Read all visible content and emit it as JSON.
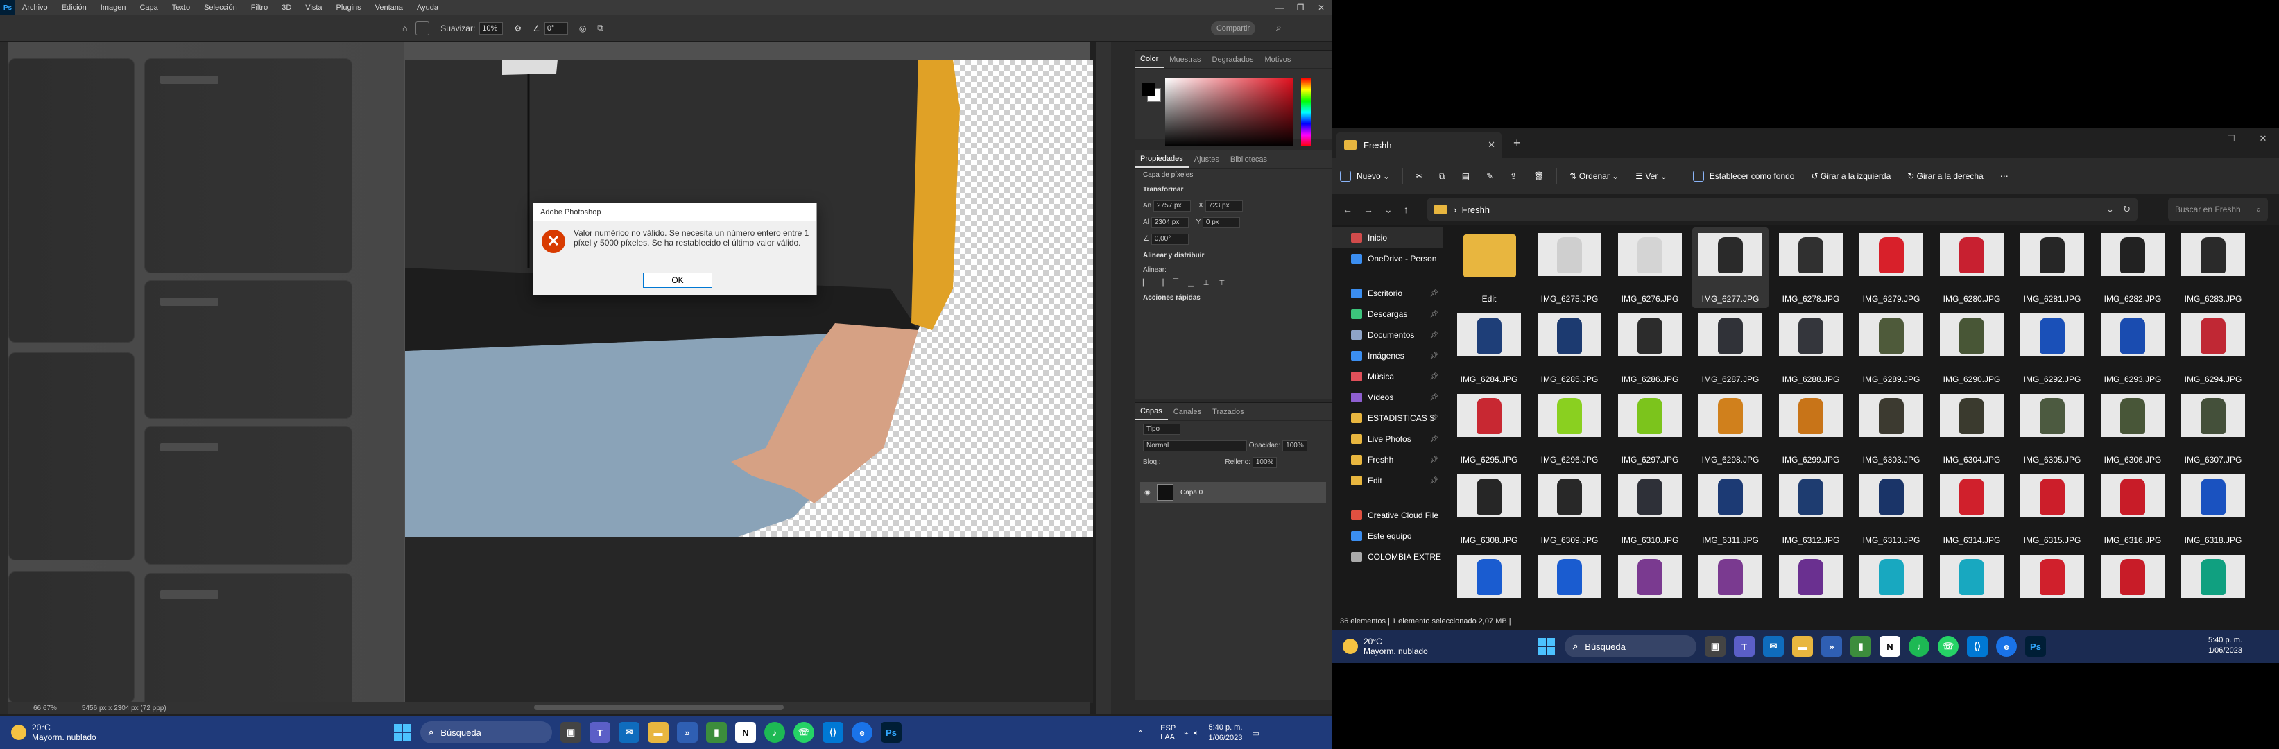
{
  "photoshop": {
    "menus": [
      "Archivo",
      "Edición",
      "Imagen",
      "Capa",
      "Texto",
      "Selección",
      "Filtro",
      "3D",
      "Vista",
      "Plugins",
      "Ventana",
      "Ayuda"
    ],
    "options": {
      "smooth_label": "Suavizar:",
      "smooth_value": "10%",
      "angle_value": "0°",
      "share_label": "Compartir"
    },
    "dialog": {
      "title": "Adobe Photoshop",
      "message": "Valor numérico no válido. Se necesita un número entero entre 1 píxel y 5000 píxeles. Se ha restablecido el último valor válido.",
      "ok_label": "OK"
    },
    "status": {
      "zoom": "66,67%",
      "size": "5456 px x 2304 px (72 ppp)"
    },
    "color_panel": {
      "tabs": [
        "Color",
        "Muestras",
        "Degradados",
        "Motivos"
      ]
    },
    "properties_panel": {
      "tabs": [
        "Propiedades",
        "Ajustes",
        "Bibliotecas"
      ],
      "type_label": "Capa de píxeles",
      "transform_title": "Transformar",
      "width_label": "An",
      "width_value": "2757 px",
      "x_label": "X",
      "x_value": "723 px",
      "height_label": "Al",
      "height_value": "2304 px",
      "y_label": "Y",
      "y_value": "0 px",
      "angle_value": "0,00°",
      "align_title": "Alinear y distribuir",
      "align_sub": "Alinear:",
      "quick_title": "Acciones rápidas"
    },
    "layers_panel": {
      "tabs": [
        "Capas",
        "Canales",
        "Trazados"
      ],
      "kind": "Tipo",
      "blend_mode": "Normal",
      "opacity_label": "Opacidad:",
      "opacity_value": "100%",
      "lock_label": "Bloq.:",
      "fill_label": "Relleno:",
      "fill_value": "100%",
      "layer_name": "Capa 0"
    }
  },
  "taskbar_left": {
    "weather_temp": "20°C",
    "weather_desc": "Mayorm. nublado",
    "search_label": "Búsqueda",
    "lang": "ESP",
    "lang2": "LAA",
    "time": "5:40 p. m.",
    "date": "1/06/2023"
  },
  "explorer": {
    "tab_title": "Freshh",
    "commands": {
      "new": "Nuevo",
      "sort": "Ordenar",
      "view": "Ver",
      "wallpaper": "Establecer como fondo",
      "rotate_left": "Girar a la izquierda",
      "rotate_right": "Girar a la derecha"
    },
    "path": "Freshh",
    "search_placeholder": "Buscar en Freshh",
    "sidebar": [
      {
        "label": "Inicio",
        "color": "#d14b4b"
      },
      {
        "label": "OneDrive - Person",
        "color": "#3b8ef0"
      },
      {
        "label": "Escritorio",
        "color": "#3b8ef0"
      },
      {
        "label": "Descargas",
        "color": "#3cc47c"
      },
      {
        "label": "Documentos",
        "color": "#8ea4c8"
      },
      {
        "label": "Imágenes",
        "color": "#3b8ef0"
      },
      {
        "label": "Música",
        "color": "#e0505a"
      },
      {
        "label": "Vídeos",
        "color": "#8e5fd0"
      },
      {
        "label": "ESTADISTICAS S",
        "color": "#e8b63f"
      },
      {
        "label": "Live Photos",
        "color": "#e8b63f"
      },
      {
        "label": "Freshh",
        "color": "#e8b63f"
      },
      {
        "label": "Edit",
        "color": "#e8b63f"
      },
      {
        "label": "Creative Cloud File",
        "color": "#e05040"
      },
      {
        "label": "Este equipo",
        "color": "#3b8ef0"
      },
      {
        "label": "COLOMBIA EXTRE",
        "color": "#aaaaaa"
      }
    ],
    "files": [
      {
        "name": "Edit",
        "color": "folder"
      },
      {
        "name": "IMG_6275.JPG",
        "color": "#cfcfcf"
      },
      {
        "name": "IMG_6276.JPG",
        "color": "#d4d4d4"
      },
      {
        "name": "IMG_6277.JPG",
        "color": "#2a2a2a"
      },
      {
        "name": "IMG_6278.JPG",
        "color": "#303030"
      },
      {
        "name": "IMG_6279.JPG",
        "color": "#d8202a"
      },
      {
        "name": "IMG_6280.JPG",
        "color": "#c82030"
      },
      {
        "name": "IMG_6281.JPG",
        "color": "#262626"
      },
      {
        "name": "IMG_6282.JPG",
        "color": "#222222"
      },
      {
        "name": "IMG_6283.JPG",
        "color": "#2a2a2a"
      },
      {
        "name": "IMG_6284.JPG",
        "color": "#1e3e78"
      },
      {
        "name": "IMG_6285.JPG",
        "color": "#1c3a70"
      },
      {
        "name": "IMG_6286.JPG",
        "color": "#2c2c2c"
      },
      {
        "name": "IMG_6287.JPG",
        "color": "#303238"
      },
      {
        "name": "IMG_6288.JPG",
        "color": "#34363c"
      },
      {
        "name": "IMG_6289.JPG",
        "color": "#4e5a3a"
      },
      {
        "name": "IMG_6290.JPG",
        "color": "#485636"
      },
      {
        "name": "IMG_6292.JPG",
        "color": "#1a50b8"
      },
      {
        "name": "IMG_6293.JPG",
        "color": "#1a4cb0"
      },
      {
        "name": "IMG_6294.JPG",
        "color": "#c02834"
      },
      {
        "name": "IMG_6295.JPG",
        "color": "#c82832"
      },
      {
        "name": "IMG_6296.JPG",
        "color": "#8ad020"
      },
      {
        "name": "IMG_6297.JPG",
        "color": "#7cc41c"
      },
      {
        "name": "IMG_6298.JPG",
        "color": "#d0801c"
      },
      {
        "name": "IMG_6299.JPG",
        "color": "#c87418"
      },
      {
        "name": "IMG_6303.JPG",
        "color": "#3c3a30"
      },
      {
        "name": "IMG_6304.JPG",
        "color": "#3a3a2e"
      },
      {
        "name": "IMG_6305.JPG",
        "color": "#4c5a40"
      },
      {
        "name": "IMG_6306.JPG",
        "color": "#485638"
      },
      {
        "name": "IMG_6307.JPG",
        "color": "#44503a"
      },
      {
        "name": "IMG_6308.JPG",
        "color": "#262626"
      },
      {
        "name": "IMG_6309.JPG",
        "color": "#282828"
      },
      {
        "name": "IMG_6310.JPG",
        "color": "#2e3038"
      },
      {
        "name": "IMG_6311.JPG",
        "color": "#1c3a74"
      },
      {
        "name": "IMG_6312.JPG",
        "color": "#1e3c70"
      },
      {
        "name": "IMG_6313.JPG",
        "color": "#1a3468"
      },
      {
        "name": "IMG_6314.JPG",
        "color": "#d0202c"
      },
      {
        "name": "IMG_6315.JPG",
        "color": "#cc1e2a"
      },
      {
        "name": "IMG_6316.JPG",
        "color": "#c81c28"
      },
      {
        "name": "IMG_6318.JPG",
        "color": "#1a52c0"
      }
    ],
    "partial_row_colors": [
      "#1a5cd0",
      "#1a5cd0",
      "#7a3a90",
      "#7a3a90",
      "#6a3090",
      "#18a8c0",
      "#18a8c0",
      "#d0202c",
      "#c81c28",
      "#10a080"
    ],
    "status": "36 elementos  |  1 elemento seleccionado 2,07 MB  |"
  },
  "taskbar_right": {
    "weather_temp": "20°C",
    "weather_desc": "Mayorm. nublado",
    "search_label": "Búsqueda",
    "time": "5:40 p. m.",
    "date": "1/06/2023"
  }
}
